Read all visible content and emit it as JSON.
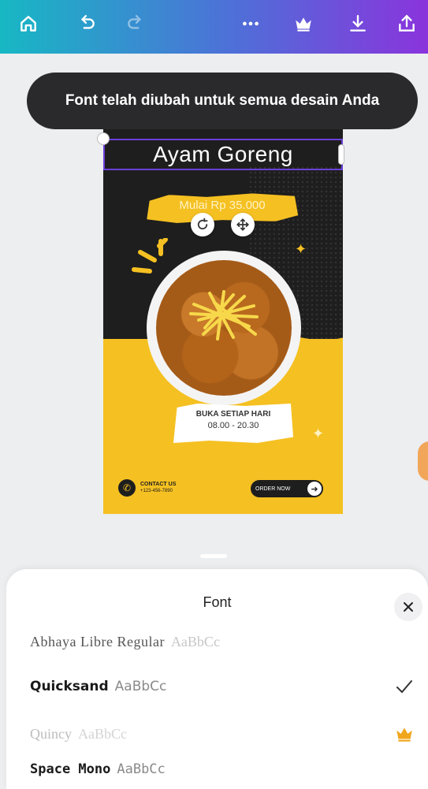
{
  "toolbar": {
    "gradient": [
      "#17b8c4",
      "#8a34dc"
    ],
    "buttons": [
      "home-icon",
      "undo-icon",
      "redo-icon",
      "more-icon",
      "crown-icon",
      "download-icon",
      "share-icon"
    ]
  },
  "toast": {
    "message": "Font telah diubah untuk semua desain Anda"
  },
  "poster": {
    "title": "Ayam Goreng",
    "price": "Mulai Rp 35.000",
    "open_label": "BUKA SETIAP HARI",
    "open_hours": "08.00 - 20.30",
    "contact_label": "CONTACT US",
    "contact_phone": "+123-456-7890",
    "order_label": "ORDER NOW",
    "accent": "#f5c022",
    "dark": "#1e1e1e"
  },
  "font_panel": {
    "title": "Font",
    "close_icon": "close-icon",
    "items": [
      {
        "name": "Abhaya Libre Regular",
        "sample": "AaBbCc",
        "state": "partial"
      },
      {
        "name": "Quicksand",
        "sample": "AaBbCc",
        "state": "selected"
      },
      {
        "name": "Quincy",
        "sample": "AaBbCc",
        "state": "premium"
      },
      {
        "name": "Space Mono",
        "sample": "AaBbCc",
        "state": "normal"
      }
    ],
    "premium_color": "#f0a61c"
  }
}
